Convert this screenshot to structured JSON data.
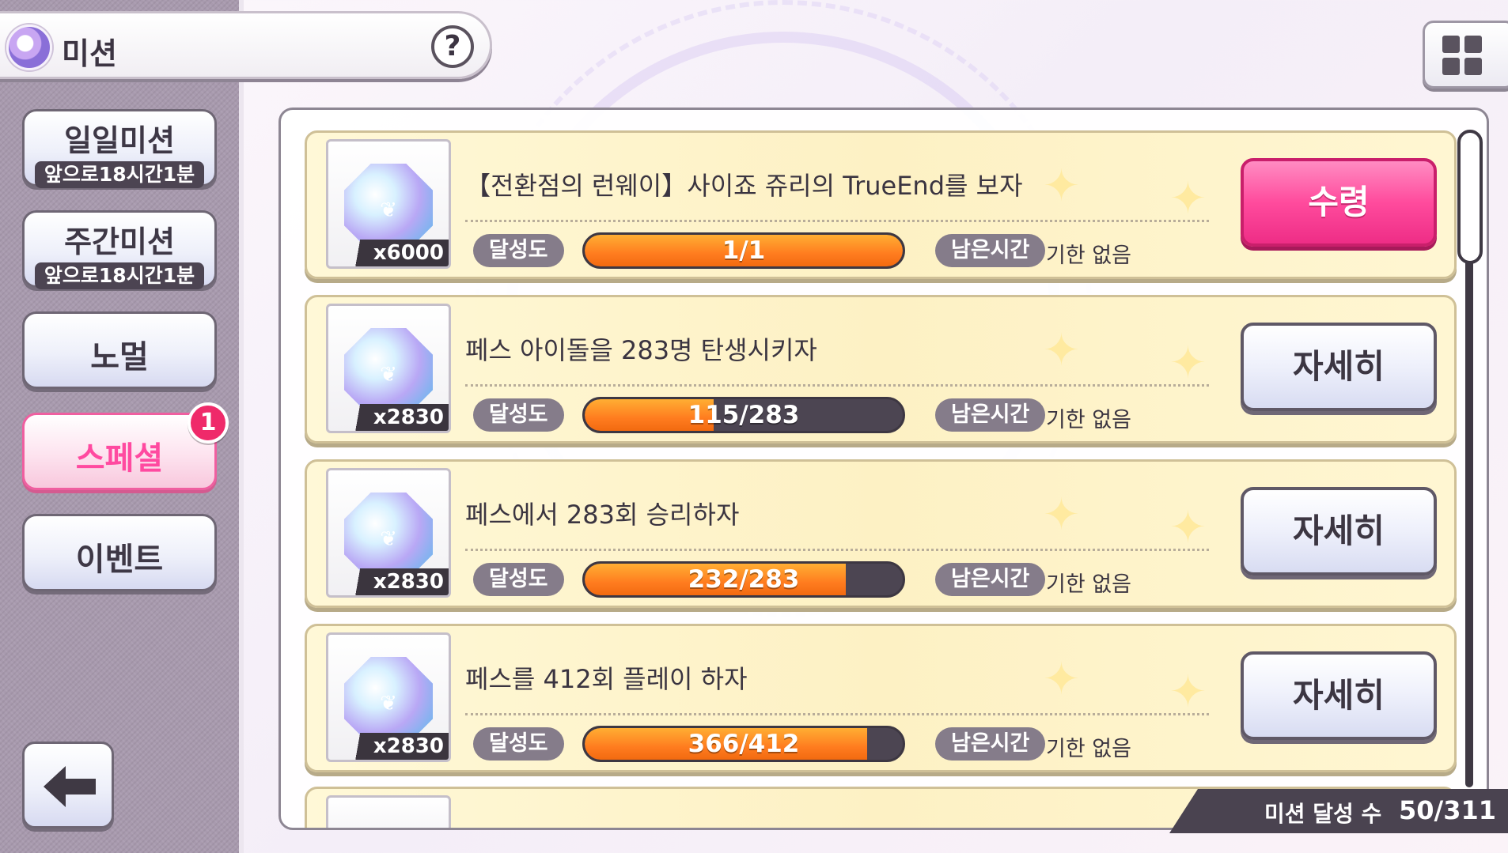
{
  "header": {
    "title": "미션",
    "help": "?"
  },
  "menu": {
    "daily": {
      "label": "일일미션",
      "sub": "앞으로18시간1분"
    },
    "weekly": {
      "label": "주간미션",
      "sub": "앞으로18시간1분"
    },
    "normal": {
      "label": "노멀"
    },
    "special": {
      "label": "스페셜",
      "badge": "1"
    },
    "event": {
      "label": "이벤트"
    }
  },
  "labels": {
    "progress": "달성도",
    "remaining": "남은시간"
  },
  "missions": [
    {
      "reward_count": "x6000",
      "title": "【전환점의 런웨이】사이죠 쥬리의 TrueEnd를 보자",
      "progress_text": "1/1",
      "progress_fraction": 1.0,
      "time": "기한 없음",
      "action": "수령",
      "action_type": "claim"
    },
    {
      "reward_count": "x2830",
      "title": "페스 아이돌을 283명 탄생시키자",
      "progress_text": "115/283",
      "progress_fraction": 0.406,
      "time": "기한 없음",
      "action": "자세히",
      "action_type": "detail"
    },
    {
      "reward_count": "x2830",
      "title": "페스에서 283회 승리하자",
      "progress_text": "232/283",
      "progress_fraction": 0.82,
      "time": "기한 없음",
      "action": "자세히",
      "action_type": "detail"
    },
    {
      "reward_count": "x2830",
      "title": "페스를 412회 플레이 하자",
      "progress_text": "366/412",
      "progress_fraction": 0.888,
      "time": "기한 없음",
      "action": "자세히",
      "action_type": "detail"
    }
  ],
  "footer": {
    "label": "미션 달성 수",
    "value": "50/311"
  },
  "colors": {
    "accent_pink": "#ff4b9d",
    "progress_orange": "#ff7c1f",
    "card_bg": "#fdf1c4",
    "panel_bg": "#a89aae"
  },
  "icons": {
    "header": "mission-emblem-icon",
    "reward": "jewel-crystal-icon",
    "back": "arrow-left-icon",
    "layout": "grid-icon"
  }
}
